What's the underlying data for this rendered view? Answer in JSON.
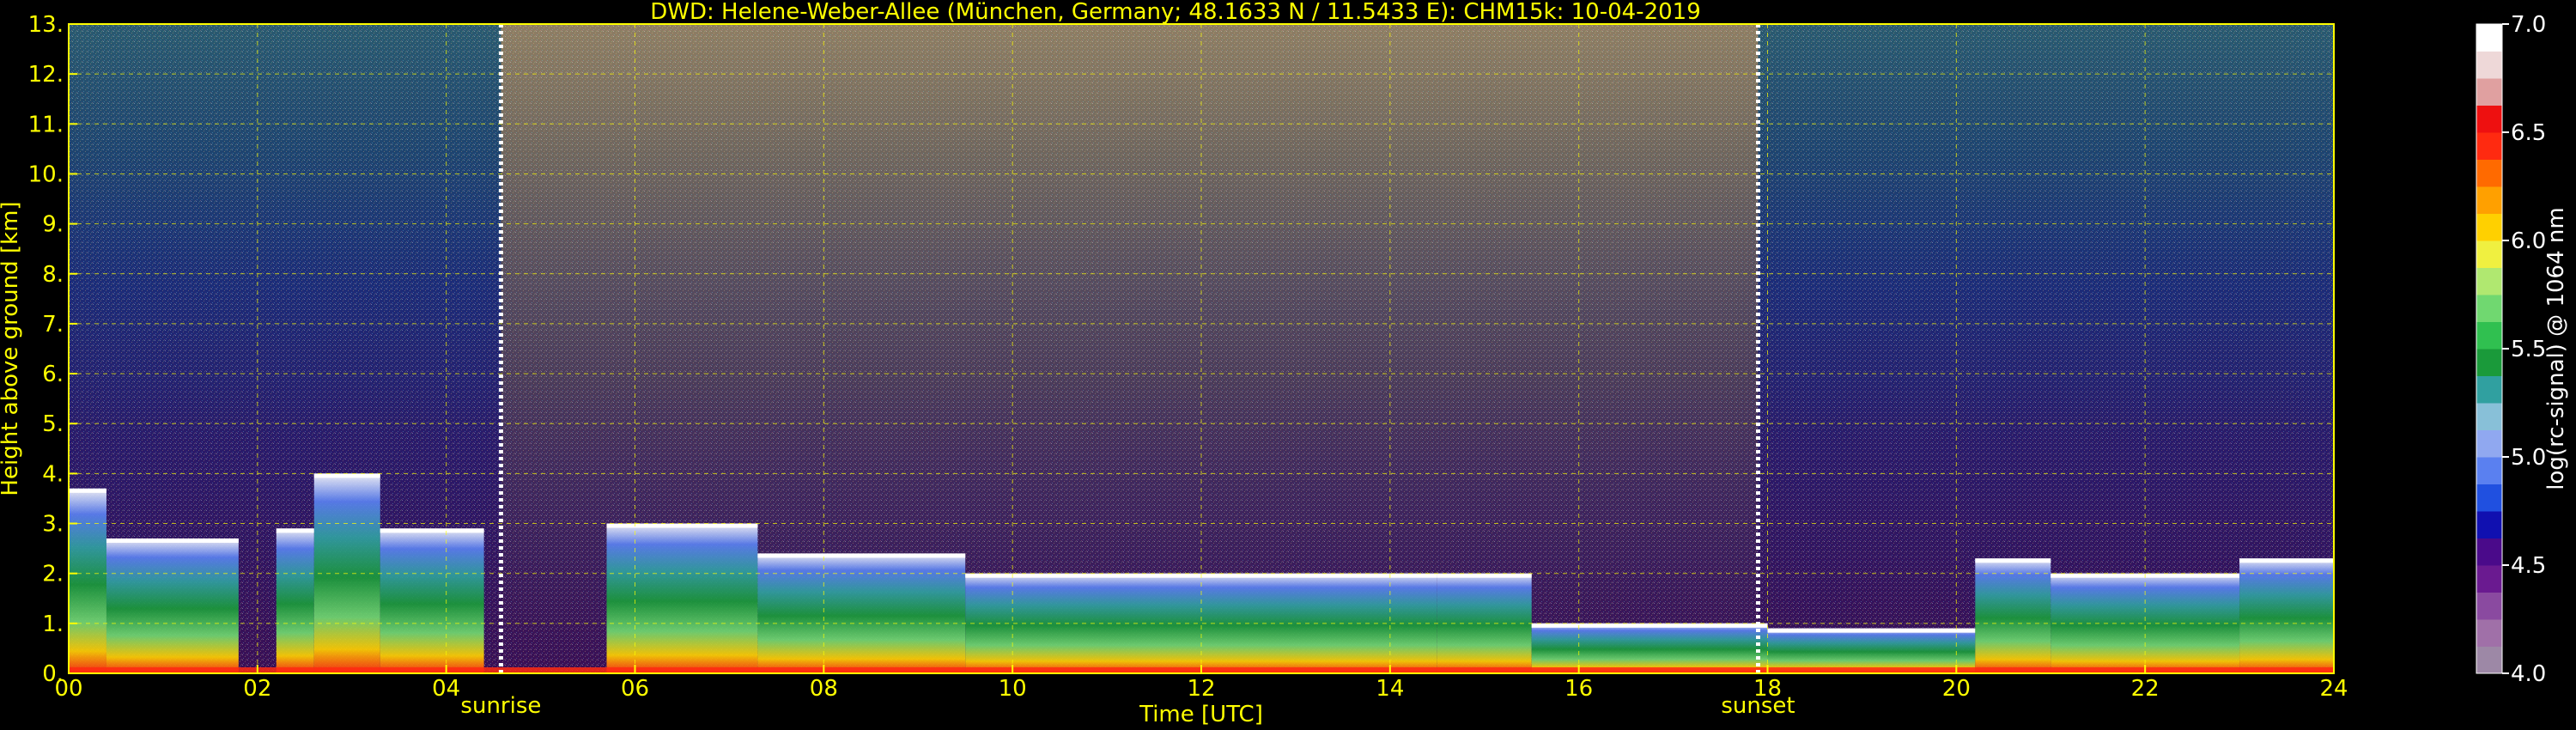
{
  "chart_data": {
    "type": "heatmap",
    "title": "DWD: Helene-Weber-Allee (München, Germany; 48.1633 N / 11.5433 E):    CHM15k: 10-04-2019",
    "xlabel": "Time [UTC]",
    "ylabel": "Height above ground [km]",
    "xlim": [
      0,
      24
    ],
    "ylim": [
      0,
      13
    ],
    "x_ticks": [
      0,
      2,
      4,
      6,
      8,
      10,
      12,
      14,
      16,
      18,
      20,
      22,
      24
    ],
    "x_tick_labels": [
      "00",
      "02",
      "04",
      "06",
      "08",
      "10",
      "12",
      "14",
      "16",
      "18",
      "20",
      "22",
      "24"
    ],
    "y_ticks": [
      0,
      1,
      2,
      3,
      4,
      5,
      6,
      7,
      8,
      9,
      10,
      11,
      12,
      13
    ],
    "y_tick_labels": [
      "0.",
      "1.",
      "2.",
      "3.",
      "4.",
      "5.",
      "6.",
      "7.",
      "8.",
      "9.",
      "10.",
      "11.",
      "12.",
      "13."
    ],
    "grid": true,
    "colorbar": {
      "label": "log(rc-signal) @ 1064 nm",
      "range": [
        4.0,
        7.0
      ],
      "ticks": [
        4.0,
        4.5,
        5.0,
        5.5,
        6.0,
        6.5,
        7.0
      ],
      "tick_labels": [
        "4.0",
        "4.5",
        "5.0",
        "5.5",
        "6.0",
        "6.5",
        "7.0"
      ],
      "colors": [
        "#9d88a6",
        "#a070a8",
        "#8a4aa0",
        "#6a1a90",
        "#4a0a8a",
        "#1010b0",
        "#2050e0",
        "#5a80f0",
        "#90a8f0",
        "#88c0d8",
        "#30a0a0",
        "#1a9a3a",
        "#30c050",
        "#70d870",
        "#b0e870",
        "#f0f040",
        "#ffd000",
        "#ffa000",
        "#ff6a00",
        "#ff2a10",
        "#ee1010",
        "#e0a0a0",
        "#eed8d8",
        "#ffffff"
      ]
    },
    "annotations": [
      {
        "label": "sunrise",
        "x": 4.58
      },
      {
        "label": "sunset",
        "x": 17.9
      }
    ],
    "signal_layers": [
      {
        "kind": "boundary_layer",
        "x_start": 0.0,
        "x_end": 0.4,
        "top_km": 3.7
      },
      {
        "kind": "boundary_layer",
        "x_start": 0.4,
        "x_end": 1.8,
        "top_km": 2.7
      },
      {
        "kind": "boundary_layer",
        "x_start": 2.2,
        "x_end": 2.6,
        "top_km": 2.9
      },
      {
        "kind": "boundary_layer",
        "x_start": 2.6,
        "x_end": 3.3,
        "top_km": 4.0
      },
      {
        "kind": "boundary_layer",
        "x_start": 3.3,
        "x_end": 4.4,
        "top_km": 2.9
      },
      {
        "kind": "boundary_layer",
        "x_start": 5.7,
        "x_end": 7.3,
        "top_km": 3.0
      },
      {
        "kind": "boundary_layer",
        "x_start": 7.3,
        "x_end": 9.5,
        "top_km": 2.4
      },
      {
        "kind": "boundary_layer",
        "x_start": 9.5,
        "x_end": 14.5,
        "top_km": 2.0
      },
      {
        "kind": "boundary_layer",
        "x_start": 14.5,
        "x_end": 15.5,
        "top_km": 2.0
      },
      {
        "kind": "boundary_layer",
        "x_start": 15.5,
        "x_end": 18.0,
        "top_km": 1.0
      },
      {
        "kind": "boundary_layer",
        "x_start": 18.0,
        "x_end": 20.2,
        "top_km": 0.9
      },
      {
        "kind": "boundary_layer",
        "x_start": 20.2,
        "x_end": 21.0,
        "top_km": 2.3
      },
      {
        "kind": "boundary_layer",
        "x_start": 21.0,
        "x_end": 23.0,
        "top_km": 2.0
      },
      {
        "kind": "boundary_layer",
        "x_start": 23.0,
        "x_end": 24.0,
        "top_km": 2.3
      }
    ]
  }
}
